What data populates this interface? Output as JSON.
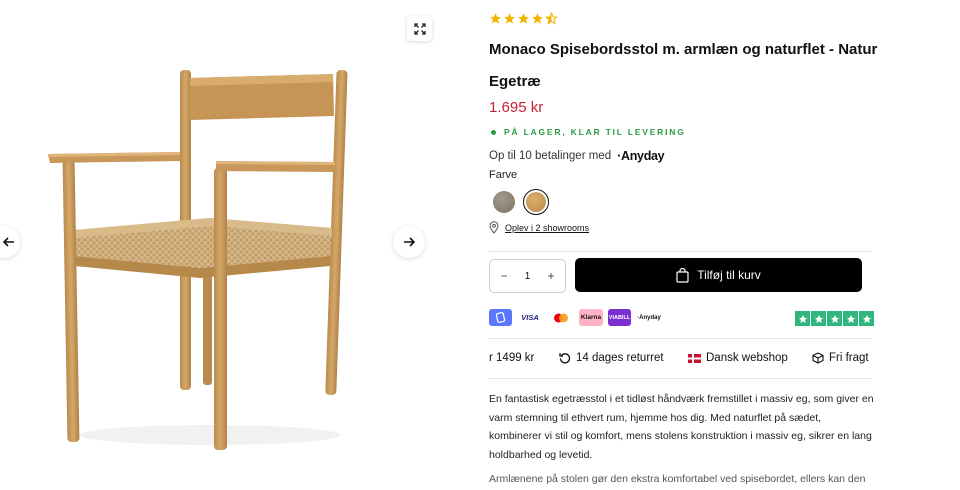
{
  "product": {
    "rating": 4.5,
    "title": "Monaco Spisebordsstol m. armlæn og naturflet - Natur Egetræ",
    "price": "1.695 kr",
    "stock_status": "PÅ LAGER, KLAR TIL LEVERING",
    "installments_text": "Op til 10 betalinger med",
    "installments_brand": "Anyday",
    "color_label": "Farve",
    "swatches": [
      {
        "name": "grey-oak",
        "color": "#8a7f72",
        "selected": false
      },
      {
        "name": "natural-oak",
        "color": "#c79a58",
        "selected": true
      }
    ],
    "showrooms_link": "Oplev i 2 showrooms"
  },
  "cart": {
    "quantity": "1",
    "minus_label": "−",
    "plus_label": "+",
    "add_to_cart_label": "Tilføj til kurv"
  },
  "payments": [
    {
      "name": "mobilepay",
      "label": "",
      "bg": "#5a78ff",
      "color": "#ffffff"
    },
    {
      "name": "visa",
      "label": "VISA",
      "bg": "#ffffff",
      "color": "#1a1f71"
    },
    {
      "name": "mastercard",
      "label": "",
      "bg": "#ffffff",
      "color": "#000000"
    },
    {
      "name": "klarna",
      "label": "Klarna",
      "bg": "#ffb3c7",
      "color": "#17120f"
    },
    {
      "name": "viabill",
      "label": "VIABILL",
      "bg": "#7b2fd1",
      "color": "#ffffff"
    },
    {
      "name": "anyday",
      "label": "·Anyday",
      "bg": "#ffffff",
      "color": "#111111"
    }
  ],
  "usps": {
    "shipping_threshold": "r 1499 kr",
    "returns": "14 dages returret",
    "webshop": "Dansk webshop",
    "freight": "Fri fragt"
  },
  "description": {
    "paragraph1": "En fantastisk egetræsstol i et tidløst håndværk fremstillet i massiv eg, som giver en varm stemning til ethvert rum, hjemme hos dig. Med naturflet på sædet, kombinerer vi stil og komfort, mens stolens konstruktion i massiv eg, sikrer en lang holdbarhed og levetid.",
    "paragraph2": "Armlænene på stolen gør den ekstra komfortabel ved spisebordet, ellers kan den"
  },
  "colors": {
    "price": "#c8202f",
    "stock": "#2c9a44",
    "star": "#f5b301",
    "trustpilot": "#2fb67c"
  }
}
